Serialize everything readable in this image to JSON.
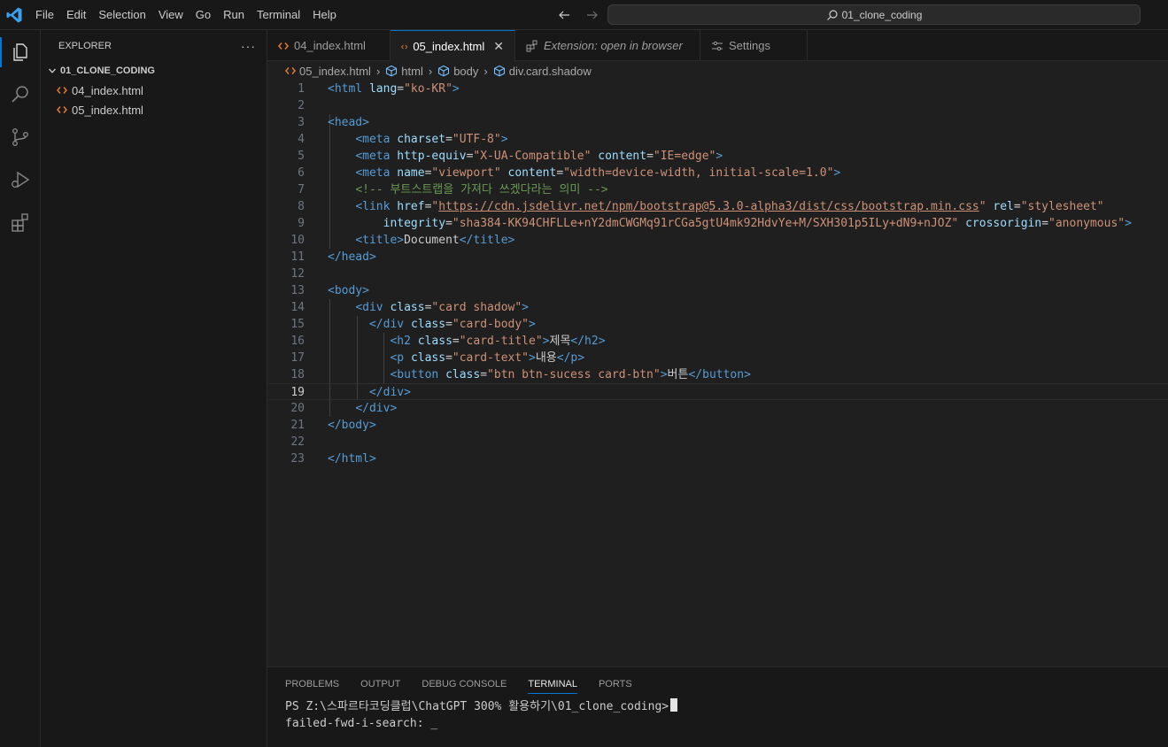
{
  "titlebar": {
    "menu": [
      "File",
      "Edit",
      "Selection",
      "View",
      "Go",
      "Run",
      "Terminal",
      "Help"
    ],
    "search": "01_clone_coding",
    "colors": {
      "logo": "#3aa0f0"
    }
  },
  "activitybar": {
    "icons": [
      "explorer-icon",
      "search-icon",
      "source-control-icon",
      "run-debug-icon",
      "extensions-icon"
    ]
  },
  "sidebar": {
    "title": "EXPLORER",
    "more": "···",
    "folder": "01_CLONE_CODING",
    "files": [
      "04_index.html",
      "05_index.html"
    ]
  },
  "tabs": [
    {
      "label": "04_index.html",
      "active": false
    },
    {
      "label": "05_index.html",
      "active": true,
      "close": "✕"
    },
    {
      "label": "Extension: open in browser",
      "active": false
    },
    {
      "label": "Settings",
      "active": false
    }
  ],
  "breadcrumb": [
    "05_index.html",
    "html",
    "body",
    "div.card.shadow"
  ],
  "editor": {
    "current_line": 19,
    "lines": [
      {
        "n": "1",
        "tokens": [
          [
            "t",
            "<html "
          ],
          [
            "a",
            "lang"
          ],
          [
            "x",
            "="
          ],
          [
            "s",
            "\"ko-KR\""
          ],
          [
            "t",
            ">"
          ]
        ]
      },
      {
        "n": "2",
        "tokens": []
      },
      {
        "n": "3",
        "tokens": [
          [
            "t",
            "<head>"
          ]
        ]
      },
      {
        "n": "4",
        "tokens": [
          [
            "x",
            "    "
          ],
          [
            "t",
            "<meta "
          ],
          [
            "a",
            "charset"
          ],
          [
            "x",
            "="
          ],
          [
            "s",
            "\"UTF-8\""
          ],
          [
            "t",
            ">"
          ]
        ]
      },
      {
        "n": "5",
        "tokens": [
          [
            "x",
            "    "
          ],
          [
            "t",
            "<meta "
          ],
          [
            "a",
            "http-equiv"
          ],
          [
            "x",
            "="
          ],
          [
            "s",
            "\"X-UA-Compatible\""
          ],
          [
            "x",
            " "
          ],
          [
            "a",
            "content"
          ],
          [
            "x",
            "="
          ],
          [
            "s",
            "\"IE=edge\""
          ],
          [
            "t",
            ">"
          ]
        ]
      },
      {
        "n": "6",
        "tokens": [
          [
            "x",
            "    "
          ],
          [
            "t",
            "<meta "
          ],
          [
            "a",
            "name"
          ],
          [
            "x",
            "="
          ],
          [
            "s",
            "\"viewport\""
          ],
          [
            "x",
            " "
          ],
          [
            "a",
            "content"
          ],
          [
            "x",
            "="
          ],
          [
            "s",
            "\"width=device-width, initial-scale=1.0\""
          ],
          [
            "t",
            ">"
          ]
        ]
      },
      {
        "n": "7",
        "tokens": [
          [
            "x",
            "    "
          ],
          [
            "c",
            "<!-- 부트스트랩을 가져다 쓰겠다라는 의미 -->"
          ]
        ]
      },
      {
        "n": "8",
        "tokens": [
          [
            "x",
            "    "
          ],
          [
            "t",
            "<link "
          ],
          [
            "a",
            "href"
          ],
          [
            "x",
            "="
          ],
          [
            "s",
            "\""
          ],
          [
            "u",
            "https://cdn.jsdelivr.net/npm/bootstrap@5.3.0-alpha3/dist/css/bootstrap.min.css"
          ],
          [
            "s",
            "\""
          ],
          [
            "x",
            " "
          ],
          [
            "a",
            "rel"
          ],
          [
            "x",
            "="
          ],
          [
            "s",
            "\"stylesheet\""
          ]
        ]
      },
      {
        "n": "9",
        "tokens": [
          [
            "x",
            "        "
          ],
          [
            "a",
            "integrity"
          ],
          [
            "x",
            "="
          ],
          [
            "s",
            "\"sha384-KK94CHFLLe+nY2dmCWGMq91rCGa5gtU4mk92HdvYe+M/SXH301p5ILy+dN9+nJOZ\""
          ],
          [
            "x",
            " "
          ],
          [
            "a",
            "crossorigin"
          ],
          [
            "x",
            "="
          ],
          [
            "s",
            "\"anonymous\""
          ],
          [
            "t",
            ">"
          ]
        ]
      },
      {
        "n": "10",
        "tokens": [
          [
            "x",
            "    "
          ],
          [
            "t",
            "<title>"
          ],
          [
            "x",
            "Document"
          ],
          [
            "t",
            "</title>"
          ]
        ]
      },
      {
        "n": "11",
        "tokens": [
          [
            "t",
            "</head>"
          ]
        ]
      },
      {
        "n": "12",
        "tokens": []
      },
      {
        "n": "13",
        "tokens": [
          [
            "t",
            "<body>"
          ]
        ]
      },
      {
        "n": "14",
        "tokens": [
          [
            "x",
            "    "
          ],
          [
            "t",
            "<div "
          ],
          [
            "a",
            "class"
          ],
          [
            "x",
            "="
          ],
          [
            "s",
            "\"card shadow\""
          ],
          [
            "t",
            ">"
          ]
        ]
      },
      {
        "n": "15",
        "tokens": [
          [
            "x",
            "      "
          ],
          [
            "t",
            "</div "
          ],
          [
            "a",
            "class"
          ],
          [
            "x",
            "="
          ],
          [
            "s",
            "\"card-body\""
          ],
          [
            "t",
            ">"
          ]
        ]
      },
      {
        "n": "16",
        "tokens": [
          [
            "x",
            "         "
          ],
          [
            "t",
            "<h2 "
          ],
          [
            "a",
            "class"
          ],
          [
            "x",
            "="
          ],
          [
            "s",
            "\"card-title\""
          ],
          [
            "t",
            ">"
          ],
          [
            "x",
            "제목"
          ],
          [
            "t",
            "</h2>"
          ]
        ]
      },
      {
        "n": "17",
        "tokens": [
          [
            "x",
            "         "
          ],
          [
            "t",
            "<p "
          ],
          [
            "a",
            "class"
          ],
          [
            "x",
            "="
          ],
          [
            "s",
            "\"card-text\""
          ],
          [
            "t",
            ">"
          ],
          [
            "x",
            "내용"
          ],
          [
            "t",
            "</p>"
          ]
        ]
      },
      {
        "n": "18",
        "tokens": [
          [
            "x",
            "         "
          ],
          [
            "t",
            "<button "
          ],
          [
            "a",
            "class"
          ],
          [
            "x",
            "="
          ],
          [
            "s",
            "\"btn btn-sucess card-btn\""
          ],
          [
            "t",
            ">"
          ],
          [
            "x",
            "버튼"
          ],
          [
            "t",
            "</button>"
          ]
        ]
      },
      {
        "n": "19",
        "tokens": [
          [
            "x",
            "      "
          ],
          [
            "t",
            "</div>"
          ]
        ]
      },
      {
        "n": "20",
        "tokens": [
          [
            "x",
            "    "
          ],
          [
            "t",
            "</div>"
          ]
        ]
      },
      {
        "n": "21",
        "tokens": [
          [
            "t",
            "</body>"
          ]
        ]
      },
      {
        "n": "22",
        "tokens": []
      },
      {
        "n": "23",
        "tokens": [
          [
            "t",
            "</html>"
          ]
        ]
      }
    ]
  },
  "panel": {
    "tabs": [
      "PROBLEMS",
      "OUTPUT",
      "DEBUG CONSOLE",
      "TERMINAL",
      "PORTS"
    ],
    "active_tab": "TERMINAL",
    "terminal": {
      "prompt": "PS Z:\\스파르타코딩클럽\\ChatGPT 300% 활용하기\\01_clone_coding>",
      "line2": "failed-fwd-i-search: _"
    }
  }
}
